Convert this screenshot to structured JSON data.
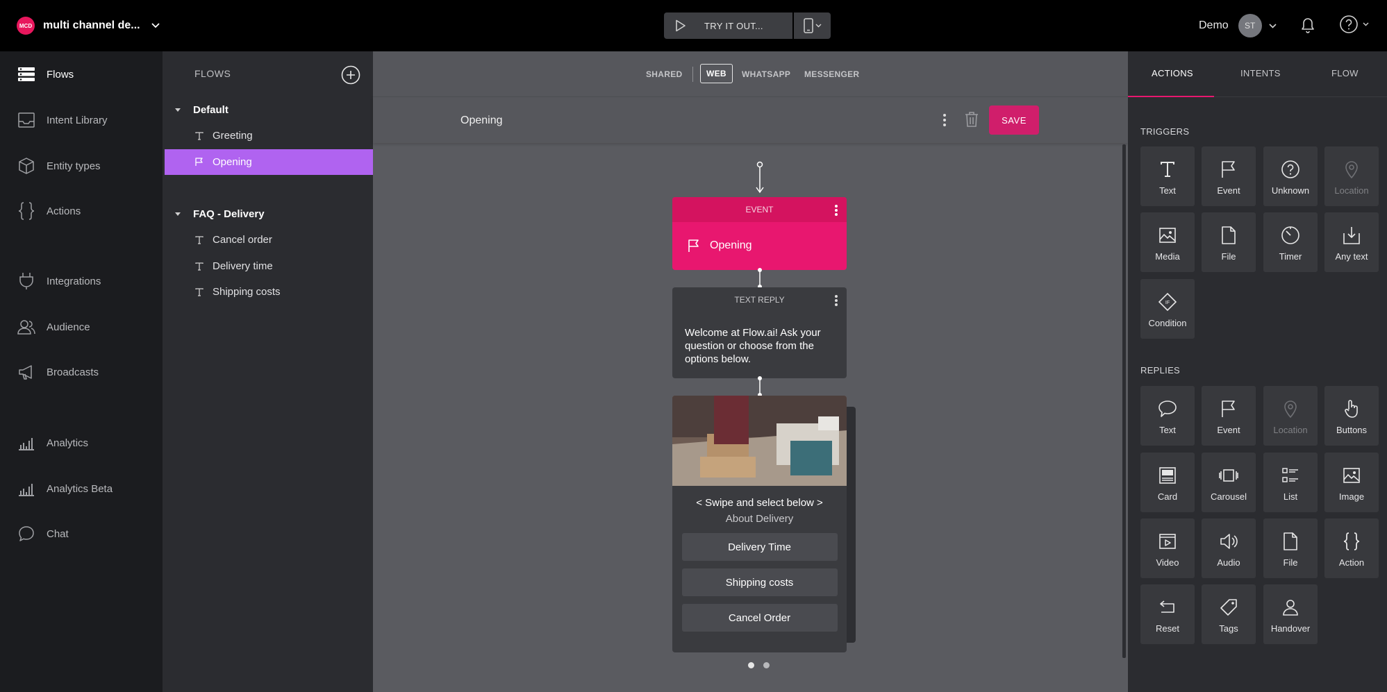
{
  "topbar": {
    "brand_initials": "MCD",
    "brand_name": "multi channel de...",
    "try_label": "TRY IT OUT...",
    "user_name": "Demo",
    "avatar_initials": "ST"
  },
  "leftnav": {
    "items": [
      {
        "label": "Flows",
        "icon": "flows-icon"
      },
      {
        "label": "Intent Library",
        "icon": "inbox-icon"
      },
      {
        "label": "Entity types",
        "icon": "cube-icon"
      },
      {
        "label": "Actions",
        "icon": "braces-icon"
      },
      {
        "label": "Integrations",
        "icon": "plug-icon"
      },
      {
        "label": "Audience",
        "icon": "users-icon"
      },
      {
        "label": "Broadcasts",
        "icon": "megaphone-icon"
      },
      {
        "label": "Analytics",
        "icon": "bar-chart-icon"
      },
      {
        "label": "Analytics Beta",
        "icon": "bar-chart-icon"
      },
      {
        "label": "Chat",
        "icon": "chat-bubble-icon"
      }
    ]
  },
  "flowspanel": {
    "title": "FLOWS",
    "groups": [
      {
        "label": "Default",
        "flows": [
          {
            "label": "Greeting",
            "icon": "text-icon"
          },
          {
            "label": "Opening",
            "icon": "flag-icon"
          }
        ]
      },
      {
        "label": "FAQ - Delivery",
        "flows": [
          {
            "label": "Cancel order",
            "icon": "text-icon"
          },
          {
            "label": "Delivery time",
            "icon": "text-icon"
          },
          {
            "label": "Shipping costs",
            "icon": "text-icon"
          }
        ]
      }
    ]
  },
  "channels": {
    "shared": "SHARED",
    "web": "WEB",
    "whatsapp": "WHATSAPP",
    "messenger": "MESSENGER"
  },
  "editor": {
    "title": "Opening",
    "save_label": "SAVE"
  },
  "nodes": {
    "event": {
      "header": "EVENT",
      "label": "Opening"
    },
    "text_reply": {
      "header": "TEXT REPLY",
      "message": "Welcome at Flow.ai! Ask your question or choose from the options below."
    },
    "card": {
      "title": "< Swipe and select below >",
      "subtitle": "About Delivery",
      "buttons": [
        "Delivery Time",
        "Shipping costs",
        "Cancel Order"
      ]
    }
  },
  "palette": {
    "tabs": [
      "ACTIONS",
      "INTENTS",
      "FLOW"
    ],
    "triggers_title": "TRIGGERS",
    "triggers": [
      {
        "label": "Text",
        "icon": "text-t-icon",
        "disabled": false
      },
      {
        "label": "Event",
        "icon": "flag-icon",
        "disabled": false
      },
      {
        "label": "Unknown",
        "icon": "question-icon",
        "disabled": false
      },
      {
        "label": "Location",
        "icon": "location-pin-icon",
        "disabled": true
      },
      {
        "label": "Media",
        "icon": "image-icon",
        "disabled": false
      },
      {
        "label": "File",
        "icon": "file-icon",
        "disabled": false
      },
      {
        "label": "Timer",
        "icon": "timer-icon",
        "disabled": false
      },
      {
        "label": "Any text",
        "icon": "download-icon",
        "disabled": false
      },
      {
        "label": "Condition",
        "icon": "condition-diamond-icon",
        "disabled": false
      }
    ],
    "replies_title": "REPLIES",
    "replies": [
      {
        "label": "Text",
        "icon": "speech-bubble-icon",
        "disabled": false
      },
      {
        "label": "Event",
        "icon": "flag-icon",
        "disabled": false
      },
      {
        "label": "Location",
        "icon": "location-pin-icon",
        "disabled": true
      },
      {
        "label": "Buttons",
        "icon": "pointer-hand-icon",
        "disabled": false
      },
      {
        "label": "Card",
        "icon": "card-icon",
        "disabled": false
      },
      {
        "label": "Carousel",
        "icon": "carousel-icon",
        "disabled": false
      },
      {
        "label": "List",
        "icon": "list-icon",
        "disabled": false
      },
      {
        "label": "Image",
        "icon": "image-icon",
        "disabled": false
      },
      {
        "label": "Video",
        "icon": "video-icon",
        "disabled": false
      },
      {
        "label": "Audio",
        "icon": "speaker-icon",
        "disabled": false
      },
      {
        "label": "File",
        "icon": "file-icon",
        "disabled": false
      },
      {
        "label": "Action",
        "icon": "braces-icon",
        "disabled": false
      },
      {
        "label": "Reset",
        "icon": "reset-icon",
        "disabled": false
      },
      {
        "label": "Tags",
        "icon": "tag-icon",
        "disabled": false
      },
      {
        "label": "Handover",
        "icon": "person-icon",
        "disabled": false
      }
    ]
  },
  "colors": {
    "accent_pink": "#e8176f",
    "active_flow_purple": "#b063f0",
    "save_button": "#d01e6b"
  }
}
